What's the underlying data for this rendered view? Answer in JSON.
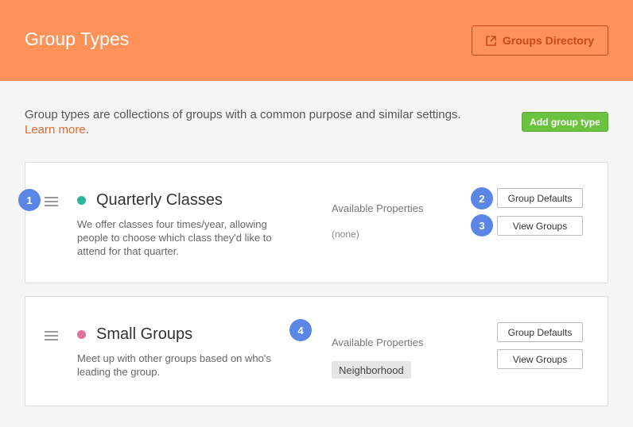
{
  "header": {
    "title": "Group Types",
    "directory_button": "Groups Directory",
    "bg_color": "#ff9259"
  },
  "intro": {
    "text": "Group types are collections of groups with a common purpose and similar settings.",
    "link": "Learn more",
    "link_suffix": "."
  },
  "add_button": "Add group type",
  "group_types": [
    {
      "name": "Quarterly Classes",
      "color": "#2bb5a0",
      "description": "We offer classes four times/year, allowing people to choose which class they'd like to attend for that quarter.",
      "properties_label": "Available Properties",
      "properties_value": "(none)",
      "defaults_button": "Group Defaults",
      "view_button": "View Groups"
    },
    {
      "name": "Small Groups",
      "color": "#e0719a",
      "description": "Meet up with other groups based on who's leading the group.",
      "properties_label": "Available Properties",
      "properties_tag": "Neighborhood",
      "defaults_button": "Group Defaults",
      "view_button": "View Groups"
    }
  ],
  "badges": [
    "1",
    "2",
    "3",
    "4"
  ]
}
